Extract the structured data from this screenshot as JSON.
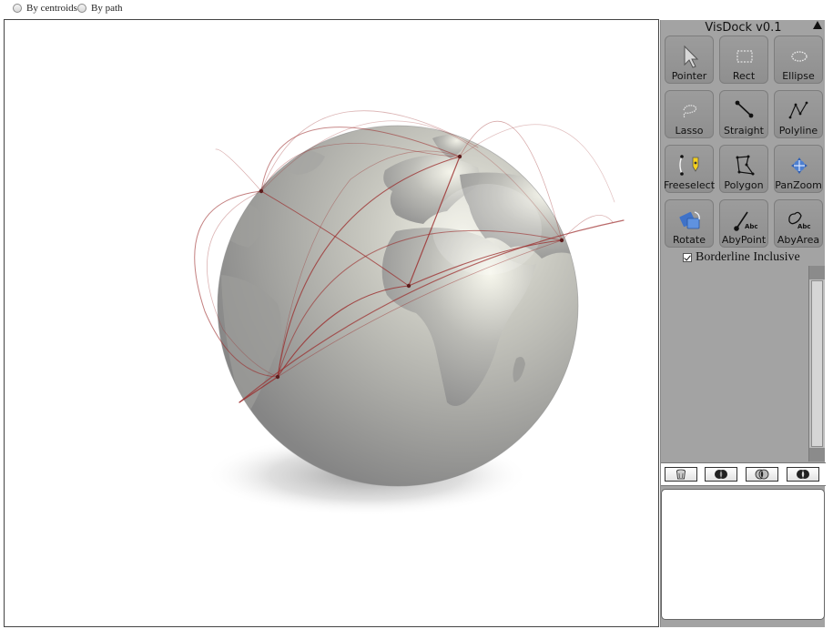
{
  "view_options": {
    "by_centroids": {
      "label": "By centroids",
      "selected": false
    },
    "by_path": {
      "label": "By path",
      "selected": false
    }
  },
  "dock": {
    "title": "VisDock v0.1",
    "tools": [
      {
        "label": "Pointer",
        "icon": "pointer-icon"
      },
      {
        "label": "Rect",
        "icon": "rect-select-icon"
      },
      {
        "label": "Ellipse",
        "icon": "ellipse-select-icon"
      },
      {
        "label": "Lasso",
        "icon": "lasso-icon"
      },
      {
        "label": "Straight",
        "icon": "straight-line-icon"
      },
      {
        "label": "Polyline",
        "icon": "polyline-icon"
      },
      {
        "label": "Freeselect",
        "icon": "freeselect-icon"
      },
      {
        "label": "Polygon",
        "icon": "polygon-icon"
      },
      {
        "label": "PanZoom",
        "icon": "panzoom-icon"
      },
      {
        "label": "Rotate",
        "icon": "rotate-icon"
      },
      {
        "label": "AbyPoint",
        "icon": "annotate-by-point-icon"
      },
      {
        "label": "AbyArea",
        "icon": "annotate-by-area-icon"
      }
    ],
    "borderline_inclusive": {
      "label": "Borderline Inclusive",
      "checked": true
    },
    "operators": [
      {
        "name": "clear-icon"
      },
      {
        "name": "intersect-icon"
      },
      {
        "name": "union-icon"
      },
      {
        "name": "xor-icon"
      }
    ]
  },
  "colors": {
    "dock_bg": "#a3a3a3",
    "tool_bg": "#949494",
    "route_line": "#9b2a2a"
  }
}
